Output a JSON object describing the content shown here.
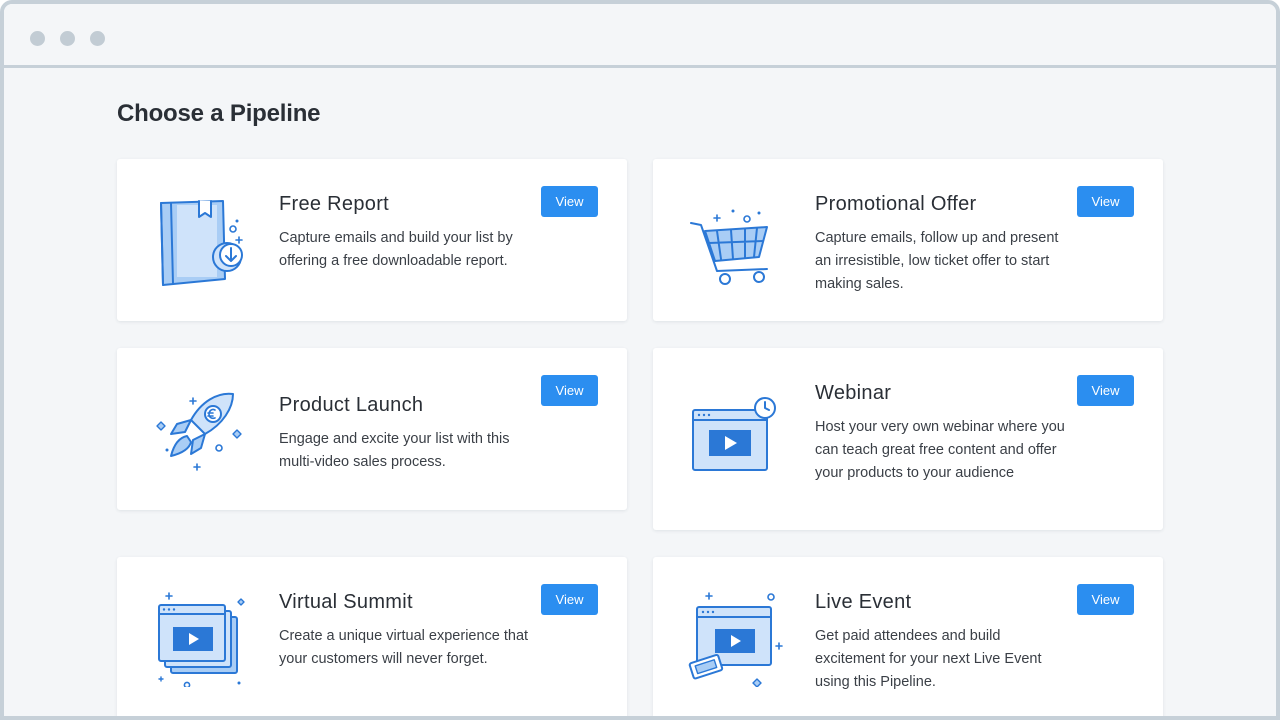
{
  "window": {
    "controls": [
      "close",
      "minimize",
      "maximize"
    ]
  },
  "page": {
    "title": "Choose a Pipeline"
  },
  "colors": {
    "accent": "#2b8ef0",
    "icon_stroke": "#2b78d6",
    "icon_fill": "#a9cdf5"
  },
  "cards": [
    {
      "id": "free-report",
      "icon": "book-download-icon",
      "title": "Free Report",
      "description": "Capture emails and build your list by offering a free downloadable report.",
      "button": "View"
    },
    {
      "id": "promotional-offer",
      "icon": "shopping-cart-icon",
      "title": "Promotional Offer",
      "description": "Capture emails, follow up and present an irresistible, low ticket offer to start making sales.",
      "button": "View"
    },
    {
      "id": "product-launch",
      "icon": "rocket-icon",
      "title": "Product Launch",
      "description": "Engage and excite your list with this multi-video sales process.",
      "button": "View"
    },
    {
      "id": "webinar",
      "icon": "video-clock-icon",
      "title": "Webinar",
      "description": "Host your very own webinar where you can teach great free content and offer your products to your audience",
      "button": "View"
    },
    {
      "id": "virtual-summit",
      "icon": "stacked-video-icon",
      "title": "Virtual Summit",
      "description": "Create a unique virtual experience that your customers will never forget.",
      "button": "View"
    },
    {
      "id": "live-event",
      "icon": "video-ticket-icon",
      "title": "Live Event",
      "description": "Get paid attendees and build excitement for your next Live Event using this Pipeline.",
      "button": "View"
    }
  ]
}
